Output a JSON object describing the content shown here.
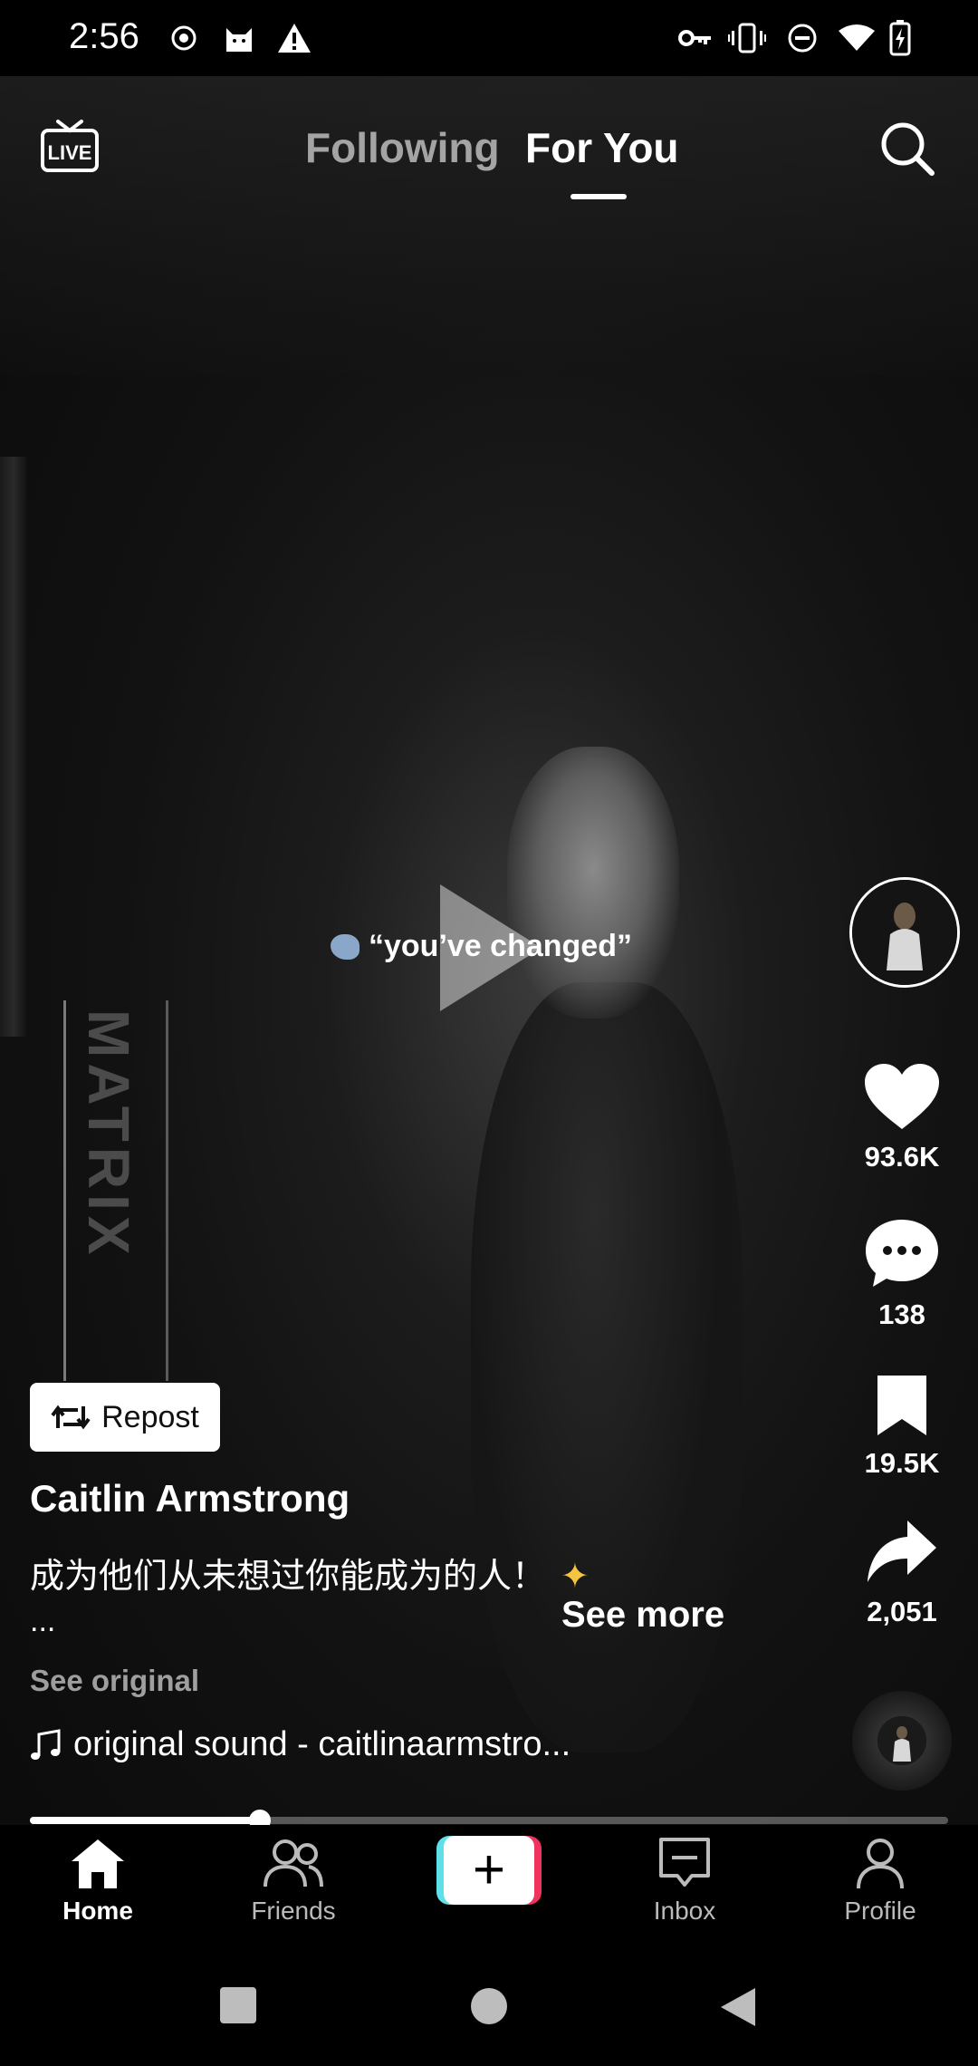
{
  "status_bar": {
    "time": "2:56",
    "left_icons": [
      "record-icon",
      "cat-icon",
      "warning-icon"
    ],
    "right_icons": [
      "key-icon",
      "vibrate-icon",
      "do-not-disturb-icon",
      "wifi-icon",
      "battery-charging-icon"
    ]
  },
  "top_bar": {
    "live_label": "LIVE",
    "tabs": [
      {
        "label": "Following",
        "active": false
      },
      {
        "label": "For You",
        "active": true
      }
    ]
  },
  "video": {
    "caption": "“you’ve changed”",
    "background_text": "MATRIX"
  },
  "rail": {
    "likes": "93.6K",
    "comments": "138",
    "saves": "19.5K",
    "shares": "2,051"
  },
  "post": {
    "repost_label": "Repost",
    "username": "Caitlin Armstrong",
    "description": "成为他们从未想过你能成为的人！",
    "ellipsis": "...",
    "see_more": "See more",
    "see_original": "See original",
    "sound": "original sound - caitlinaarmstro..."
  },
  "progress": {
    "value": 0.25
  },
  "bottom_nav": {
    "items": [
      {
        "label": "Home",
        "active": true
      },
      {
        "label": "Friends",
        "active": false
      },
      {
        "label": "Inbox",
        "active": false
      },
      {
        "label": "Profile",
        "active": false
      }
    ]
  },
  "colors": {
    "accent_cyan": "#5fe0e8",
    "accent_red": "#f0335c",
    "background": "#000000",
    "sparkle": "#f5c542"
  }
}
